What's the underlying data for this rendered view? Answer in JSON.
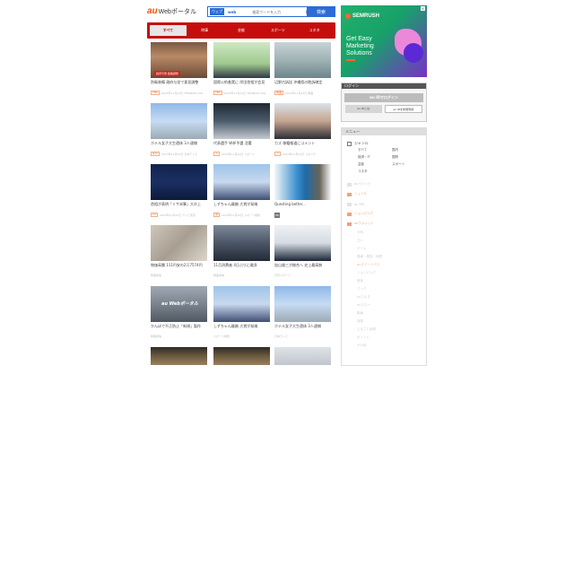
{
  "header": {
    "logo_au": "au",
    "logo_rest": "Webポータル",
    "search_tab": "ウェブ",
    "search_engine": "web",
    "search_placeholder": "検索ワードを入力",
    "search_button": "検索"
  },
  "tabs": [
    {
      "label": "すべて",
      "active": true
    },
    {
      "label": "時事",
      "active": false
    },
    {
      "label": "芸能",
      "active": false
    },
    {
      "label": "スポーツ",
      "active": false
    },
    {
      "label": "コネタ",
      "active": false
    }
  ],
  "articles": [
    {
      "title": "防衛装備 政府与党で意見調整",
      "meta": "2023年11月22日 TBSNEWS DIG",
      "src": "TBS",
      "badge": "速報",
      "badge2": "政府与党 政策調整",
      "thumb": "t-parl"
    },
    {
      "title": "国際公約着実に 岸田首相が会見",
      "meta": "2023年11月22日 TBSNEWS DIG",
      "src": "TBS",
      "thumb": "t-man"
    },
    {
      "title": "辺野古訴訟 沖縄県の敗訴確定",
      "meta": "2023年11月22日 時事",
      "src": "時事",
      "thumb": "t-aerial"
    },
    {
      "title": "ホテル女子大生遺体 3人逮捕",
      "meta": "2023年11月22日 日本テレビ",
      "src": "NTV",
      "thumb": "t-bldg"
    },
    {
      "title": "代表選手 W杯予選 活躍",
      "meta": "2023年11月22日 スポーツ",
      "src": "ス",
      "thumb": "t-soccer"
    },
    {
      "title": "カズ 移籍報道にコメント",
      "meta": "2023年11月22日 スポニチ",
      "src": "ス",
      "thumb": "t-face"
    },
    {
      "title": "首相が表明「ミサ米撃」大炎上",
      "meta": "2023年11月22日 テレビ東京",
      "src": "TX",
      "thumb": "t-navy"
    },
    {
      "title": "しずちゃん離婚 大賞が発端",
      "meta": "2023年11月22日 スポーツ報知",
      "src": "報",
      "thumb": "t-girls"
    },
    {
      "title": "Questing better...",
      "meta": "",
      "ad": "PR",
      "thumb": "t-jacket"
    },
    {
      "title": "物価高騰 111円安の2万7574円",
      "meta": "時事通信",
      "thumb": "t-money"
    },
    {
      "title": "11月消費者 4日ぶりに最多",
      "meta": "時事通信",
      "thumb": "t-crowd"
    },
    {
      "title": "加山雄三が総合へ 史上最高齢",
      "meta": "日刊スポーツ",
      "thumb": "t-suit"
    },
    {
      "title": "かんぽで不正防止「新規」製作",
      "meta": "時事通信",
      "watermark": "au Webポータル",
      "thumb": "t-city"
    },
    {
      "title": "しずちゃん離婚 大賞が発端",
      "meta": "スポーツ報知",
      "thumb": "t-girls"
    },
    {
      "title": "ホテル女子大生遺体 3人逮捕",
      "meta": "日本テレビ",
      "thumb": "t-bldg"
    },
    {
      "title": "",
      "meta": "",
      "thumb": "t-dark"
    },
    {
      "title": "",
      "meta": "",
      "thumb": "t-dark"
    },
    {
      "title": "",
      "meta": "",
      "thumb": "t-light"
    }
  ],
  "ad": {
    "brand": "SEMRUSH",
    "copy": "Get Easy Marketing Solutions",
    "close": "x",
    "colors": {
      "start": "#20b26b",
      "end": "#7a2ec8",
      "accent": "#ff642d"
    }
  },
  "login": {
    "head": "ログイン",
    "main_button": "au IDでログイン",
    "left_button": "au IDとは",
    "right_button": "au IDを新規登録"
  },
  "menu": {
    "head": "メニュー",
    "genre_label": "ジャンル",
    "genres": [
      "すべて",
      "国内",
      "経済・IT",
      "国際",
      "芸能",
      "スポーツ",
      "コネタ"
    ],
    "services": [
      {
        "label": "auペイシピ",
        "orange": false
      },
      {
        "label": "ニュース",
        "orange": true
      },
      {
        "label": "au PAY",
        "orange": false
      },
      {
        "label": "ショッピング",
        "orange": true
      },
      {
        "label": "auウォレット",
        "orange": true
      }
    ],
    "subs": [
      {
        "label": "天気",
        "orange": false
      },
      {
        "label": "占い",
        "orange": false
      },
      {
        "label": "ゲーム",
        "orange": false
      },
      {
        "label": "路線・乗換・地図",
        "orange": false
      },
      {
        "label": "auスマートパス",
        "orange": true
      },
      {
        "label": "ショッピング",
        "orange": false
      },
      {
        "label": "音楽",
        "orange": false
      },
      {
        "label": "ブック",
        "orange": false
      },
      {
        "label": "auでんき",
        "orange": false
      },
      {
        "label": "auマネー",
        "orange": false
      },
      {
        "label": "動画",
        "orange": false
      },
      {
        "label": "保険",
        "orange": false
      },
      {
        "label": "ふるさと納税",
        "orange": false
      },
      {
        "label": "ポイント",
        "orange": false
      },
      {
        "label": "その他",
        "orange": false
      }
    ]
  }
}
